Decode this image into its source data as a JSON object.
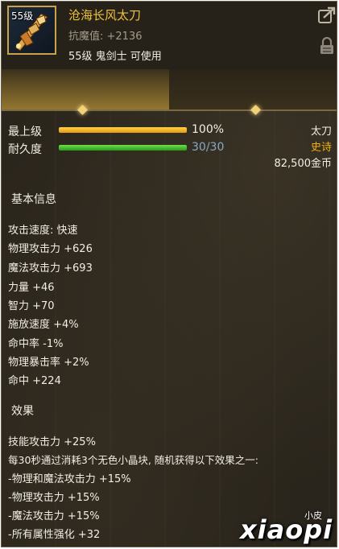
{
  "item": {
    "level_badge": "55级",
    "name": "沧海长风太刀",
    "resist": "抗魔值: +2136",
    "requirement": "55级 鬼剑士 可使用",
    "weapon_type": "太刀",
    "rarity": "史诗",
    "price": "82,500金币"
  },
  "stats": {
    "upgrade": {
      "label": "最上级",
      "value": "100%",
      "fraction": 1.0
    },
    "durability": {
      "label": "耐久度",
      "value": "30/30",
      "fraction": 1.0
    }
  },
  "basic_info": {
    "title": "基本信息",
    "lines": [
      "攻击速度: 快速",
      "物理攻击力 +626",
      "魔法攻击力 +693",
      "力量 +46",
      "智力 +70",
      "施放速度 +4%",
      "命中率 -1%",
      "物理暴击率 +2%",
      "命中 +224"
    ]
  },
  "effects": {
    "title": "效果",
    "lines": [
      "技能攻击力 +25%",
      "每30秒通过消耗3个无色小晶块, 随机获得以下效果之一:",
      "-物理和魔法攻击力 +15%",
      "-物理攻击力 +15%",
      "-魔法攻击力 +15%",
      "-所有属性强化 +32"
    ]
  },
  "watermark": {
    "small": "小皮",
    "big": "xiaopi"
  },
  "icons": {
    "share": "share-icon",
    "lock": "lock-icon",
    "item": "sword-item-icon"
  },
  "colors": {
    "name": "#f0c23a",
    "rarity": "#f0b010",
    "upgrade_bar": "#f0b020",
    "durability_bar": "#3fbf2a"
  }
}
